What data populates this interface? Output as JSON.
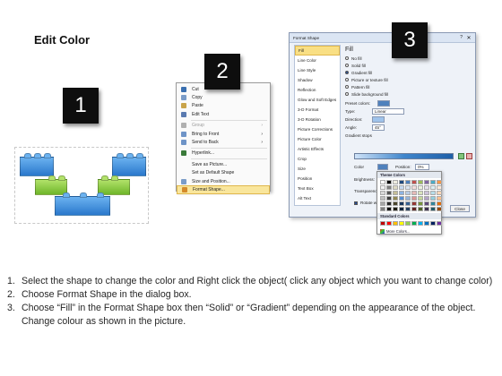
{
  "slide": {
    "title": "Edit Color"
  },
  "badges": [
    "1",
    "2",
    "3"
  ],
  "context_menu": {
    "items": [
      {
        "label": "Cut",
        "icon": "scissors-icon",
        "enabled": true
      },
      {
        "label": "Copy",
        "icon": "copy-icon",
        "enabled": true
      },
      {
        "label": "Paste",
        "icon": "paste-icon",
        "enabled": true
      },
      {
        "label": "Edit Text",
        "icon": "edit-text-icon",
        "enabled": true
      },
      {
        "label": "Group",
        "icon": "group-icon",
        "enabled": false,
        "submenu": true
      },
      {
        "label": "Bring to Front",
        "icon": "bring-front-icon",
        "enabled": true,
        "submenu": true
      },
      {
        "label": "Send to Back",
        "icon": "send-back-icon",
        "enabled": true,
        "submenu": true
      },
      {
        "label": "Hyperlink...",
        "icon": "hyperlink-icon",
        "enabled": true
      },
      {
        "label": "Save as Picture...",
        "icon": "",
        "enabled": true
      },
      {
        "label": "Set as Default Shape",
        "icon": "",
        "enabled": true
      },
      {
        "label": "Size and Position...",
        "icon": "size-icon",
        "enabled": true
      },
      {
        "label": "Format Shape...",
        "icon": "format-shape-icon",
        "enabled": true,
        "selected": true
      }
    ]
  },
  "format_dialog": {
    "title": "Format Shape",
    "help": "?",
    "close": "✕",
    "nav": [
      "Fill",
      "Line Color",
      "Line Style",
      "Shadow",
      "Reflection",
      "Glow and Soft Edges",
      "3-D Format",
      "3-D Rotation",
      "Picture Corrections",
      "Picture Color",
      "Artistic Effects",
      "Crop",
      "Size",
      "Position",
      "Text Box",
      "Alt Text"
    ],
    "fill_heading": "Fill",
    "fill_options": [
      "No fill",
      "Solid fill",
      "Gradient fill",
      "Picture or texture fill",
      "Pattern fill",
      "Slide background fill"
    ],
    "preset_colors_label": "Preset colors:",
    "type_label": "Type:",
    "type_value": "Linear",
    "direction_label": "Direction:",
    "angle_label": "Angle:",
    "angle_value": "45°",
    "gradient_stops_label": "Gradient stops",
    "color_label": "Color",
    "position_label": "Position:",
    "position_value": "0%",
    "brightness_label": "Brightness:",
    "transparency_label": "Transparency:",
    "rotate_label": "Rotate with shape",
    "close_button": "Close"
  },
  "color_popup": {
    "theme_heading": "Theme Colors",
    "standard_heading": "Standard Colors",
    "more_label": "More Colors...",
    "theme_top": [
      "#ffffff",
      "#000000",
      "#eeece1",
      "#1f497d",
      "#4f81bd",
      "#c0504d",
      "#9bbb59",
      "#8064a2",
      "#4bacc6",
      "#f79646"
    ],
    "theme_shades": [
      [
        "#f2f2f2",
        "#7f7f7f",
        "#ddd9c3",
        "#c6d9f0",
        "#dbe5f1",
        "#f2dcdb",
        "#ebf1dd",
        "#e5e0ec",
        "#dbeef3",
        "#fdeada"
      ],
      [
        "#d8d8d8",
        "#595959",
        "#c4bd97",
        "#8db3e2",
        "#b8cce4",
        "#e5b9b7",
        "#d7e3bc",
        "#ccc1d9",
        "#b7dde8",
        "#fbd5b5"
      ],
      [
        "#bfbfbf",
        "#3f3f3f",
        "#938953",
        "#548dd4",
        "#95b3d7",
        "#d99694",
        "#c3d69b",
        "#b2a2c7",
        "#92cddc",
        "#fac08f"
      ],
      [
        "#a5a5a5",
        "#262626",
        "#494429",
        "#17365d",
        "#366092",
        "#953734",
        "#76923c",
        "#5f497a",
        "#31859b",
        "#e36c09"
      ],
      [
        "#7f7f7f",
        "#0c0c0c",
        "#1d1b10",
        "#0f243e",
        "#244061",
        "#632423",
        "#4f6128",
        "#3f3151",
        "#205867",
        "#974806"
      ]
    ],
    "standard": [
      "#c00000",
      "#ff0000",
      "#ffc000",
      "#ffff00",
      "#92d050",
      "#00b050",
      "#00b0f0",
      "#0070c0",
      "#002060",
      "#7030a0"
    ]
  },
  "instructions": [
    {
      "num": "1.",
      "text": "Select the shape to change the color and Right click the object( click any object which you want to change color)"
    },
    {
      "num": "2.",
      "text": "Choose Format Shape in the dialog box."
    },
    {
      "num": "3.",
      "text": "Choose “Fill” in the Format Shape box then “Solid” or “Gradient” depending on the appearance of the object. Change colour as shown in the picture."
    }
  ],
  "colors": {
    "brick_blue": "#3d8fe0",
    "brick_green": "#8ccf3a",
    "badge_bg": "#0e0e0e",
    "menu_highlight": "#f9e69c"
  }
}
